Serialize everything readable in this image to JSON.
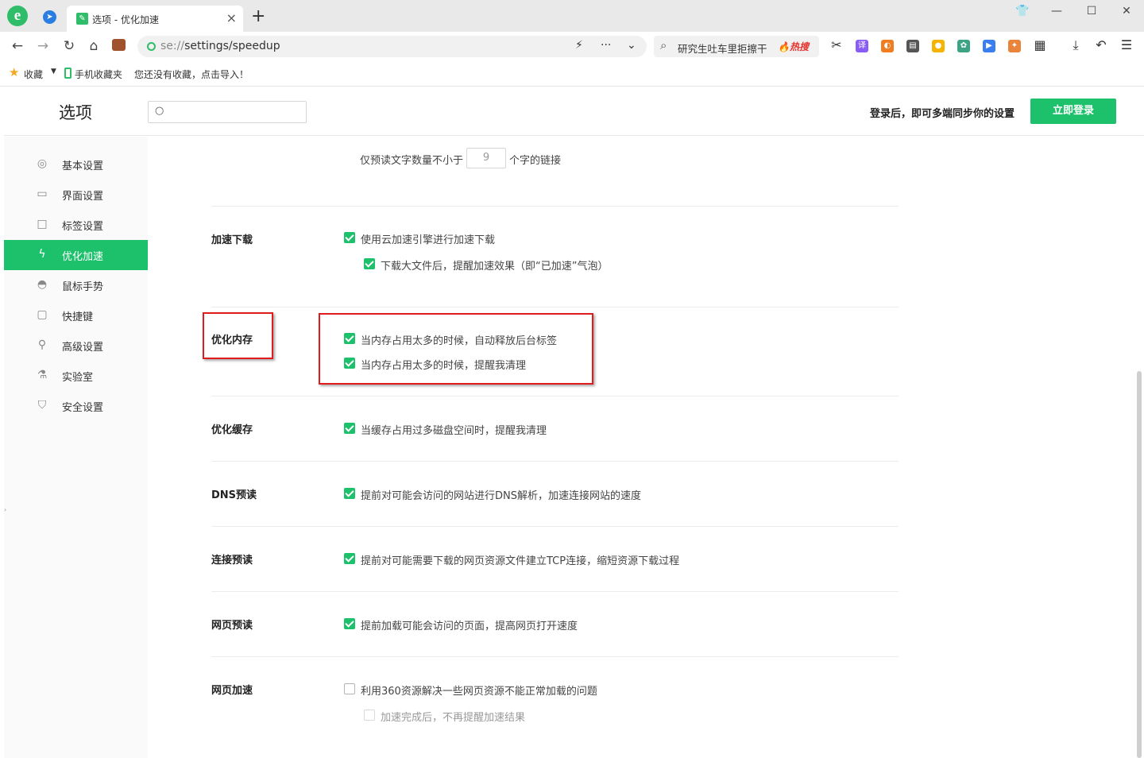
{
  "browser": {
    "tab_title": "选项 - 优化加速",
    "url_scheme": "se://",
    "url_path": "settings/speedup",
    "search_text": "研究生吐车里拒擦干",
    "hot_badge": "🔥热搜",
    "ext_translate": "译"
  },
  "bookmarks": {
    "favorites": "收藏",
    "mobile": "手机收藏夹",
    "import_hint": "您还没有收藏，点击导入！"
  },
  "header": {
    "title": "选项",
    "search_placeholder": "",
    "login_hint": "登录后，即可多端同步你的设置",
    "login_button": "立即登录"
  },
  "sidebar": {
    "items": [
      {
        "label": "基本设置",
        "icon": "gear-icon"
      },
      {
        "label": "界面设置",
        "icon": "window-icon"
      },
      {
        "label": "标签设置",
        "icon": "tab-icon"
      },
      {
        "label": "优化加速",
        "icon": "lightning-icon",
        "active": true
      },
      {
        "label": "鼠标手势",
        "icon": "mouse-icon"
      },
      {
        "label": "快捷键",
        "icon": "keyboard-icon"
      },
      {
        "label": "高级设置",
        "icon": "wrench-icon"
      },
      {
        "label": "实验室",
        "icon": "flask-icon"
      },
      {
        "label": "安全设置",
        "icon": "shield-icon"
      }
    ]
  },
  "content": {
    "prefetch": {
      "prefix": "仅预读文字数量不小于",
      "value": "9",
      "suffix": "个字的链接"
    },
    "sections": {
      "download": {
        "title": "加速下载",
        "options": [
          {
            "label": "使用云加速引擎进行加速下载",
            "checked": true
          },
          {
            "label": "下载大文件后，提醒加速效果（即“已加速”气泡）",
            "checked": true
          }
        ]
      },
      "memory": {
        "title": "优化内存",
        "options": [
          {
            "label": "当内存占用太多的时候，自动释放后台标签",
            "checked": true
          },
          {
            "label": "当内存占用太多的时候，提醒我清理",
            "checked": true
          }
        ]
      },
      "cache": {
        "title": "优化缓存",
        "options": [
          {
            "label": "当缓存占用过多磁盘空间时，提醒我清理",
            "checked": true
          }
        ]
      },
      "dns": {
        "title": "DNS预读",
        "options": [
          {
            "label": "提前对可能会访问的网站进行DNS解析，加速连接网站的速度",
            "checked": true
          }
        ]
      },
      "connect": {
        "title": "连接预读",
        "options": [
          {
            "label": "提前对可能需要下载的网页资源文件建立TCP连接，缩短资源下载过程",
            "checked": true
          }
        ]
      },
      "page_preload": {
        "title": "网页预读",
        "options": [
          {
            "label": "提前加载可能会访问的页面，提高网页打开速度",
            "checked": true
          }
        ]
      },
      "page_speedup": {
        "title": "网页加速",
        "options": [
          {
            "label": "利用360资源解决一些网页资源不能正常加载的问题",
            "checked": false
          },
          {
            "label": "加速完成后，不再提醒加速结果",
            "checked": false,
            "disabled": true
          }
        ]
      }
    }
  },
  "colors": {
    "accent": "#1dc06b",
    "highlight": "#e01b1b"
  }
}
